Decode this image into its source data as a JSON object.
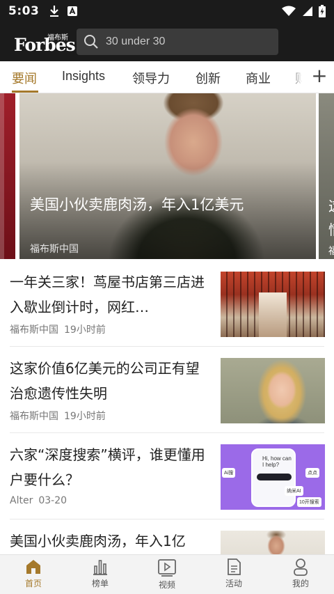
{
  "status_bar": {
    "time": "5:03"
  },
  "header": {
    "logo_en": "Forbes",
    "logo_cn": "福布斯",
    "search_placeholder": "30 under 30"
  },
  "tabs": [
    {
      "label": "要闻",
      "active": true
    },
    {
      "label": "Insights"
    },
    {
      "label": "领导力"
    },
    {
      "label": "创新"
    },
    {
      "label": "商业"
    },
    {
      "label": "财"
    }
  ],
  "carousel": {
    "title": "美国小伙卖鹿肉汤，年入1亿美元",
    "source": "福布斯中国",
    "next_peek_lines": [
      "这",
      "情",
      "福"
    ]
  },
  "news": [
    {
      "title": "一年关三家！茑屋书店第三店进入歇业倒计时，网红…",
      "source": "福布斯中国",
      "time": "19小时前"
    },
    {
      "title": "这家价值6亿美元的公司正有望治愈遗传性失明",
      "source": "福布斯中国",
      "time": "19小时前"
    },
    {
      "title": "六家“深度搜索”横评，谁更懂用户要什么？",
      "source": "Alter",
      "time": "03-20"
    },
    {
      "title": "美国小伙卖鹿肉汤，年入1亿",
      "source": "",
      "time": ""
    }
  ],
  "thumb_purple": {
    "phone_text": "Hi, how can I help?",
    "chips": [
      "Ai搜",
      "点点",
      "纳米AI",
      "10开搜索"
    ]
  },
  "bottom_nav": [
    {
      "label": "首页",
      "icon": "home-icon",
      "active": true
    },
    {
      "label": "榜单",
      "icon": "ranking-icon"
    },
    {
      "label": "视频",
      "icon": "video-icon"
    },
    {
      "label": "活动",
      "icon": "document-icon"
    },
    {
      "label": "我的",
      "icon": "profile-icon"
    }
  ],
  "colors": {
    "accent": "#a5792b",
    "header_bg": "#1b1b1b"
  }
}
